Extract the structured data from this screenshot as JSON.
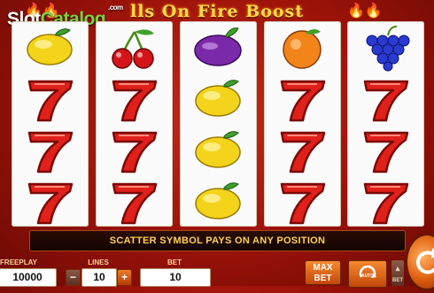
{
  "game": {
    "title": "Bells On Fire Boost",
    "title_display": "lls On Fire Boost",
    "watermark_slot": "Slot",
    "watermark_catalog": "Catalog",
    "watermark_com": ".com"
  },
  "reels": [
    [
      "lemon",
      "seven",
      "seven",
      "seven"
    ],
    [
      "cherries",
      "seven",
      "seven",
      "seven"
    ],
    [
      "plum",
      "lemon",
      "lemon",
      "lemon"
    ],
    [
      "orange",
      "seven",
      "seven",
      "seven"
    ],
    [
      "grapes",
      "seven",
      "seven",
      "seven"
    ]
  ],
  "message": "SCATTER SYMBOL PAYS ON ANY POSITION",
  "controls": {
    "freeplay_label": "FREEPLAY",
    "freeplay_value": "10000",
    "lines_label": "LINES",
    "lines_value": "10",
    "bet_label": "BET",
    "bet_value": "10",
    "minus_label": "−",
    "plus_label": "+",
    "max_label": "MAX",
    "maxbet_label": "BET",
    "auto_label": "AUTO",
    "bet_small_label": "BET"
  },
  "colors": {
    "background": "#b01e10",
    "title": "#ffd84a",
    "accent_button": "#e0631a",
    "message_text": "#ffd24a"
  }
}
